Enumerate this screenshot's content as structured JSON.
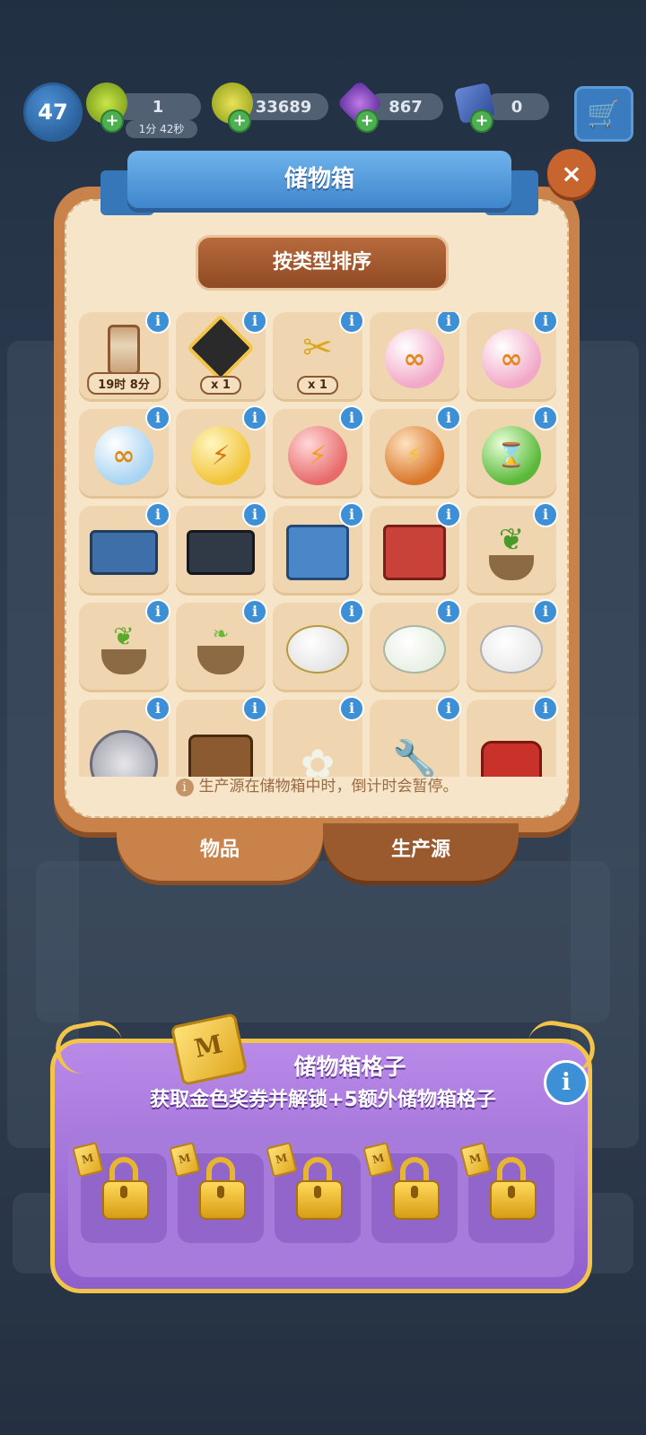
{
  "hud": {
    "level": "47",
    "energy_value": "1",
    "energy_timer": "1分 42秒",
    "coins_value": "33689",
    "gems_value": "867",
    "cards_value": "0",
    "plus_symbol": "+",
    "cart_icon": "cart-icon"
  },
  "storage": {
    "title": "储物箱",
    "close_symbol": "×",
    "sort_label": "按类型排序",
    "info_symbol": "i",
    "items": [
      {
        "name": "hourglass-timer",
        "badge": "19时 8分"
      },
      {
        "name": "energy-sign",
        "badge": "x 1"
      },
      {
        "name": "golden-scissors",
        "badge": "x 1"
      },
      {
        "name": "pink-infinity-orb",
        "badge": ""
      },
      {
        "name": "pink-infinity-orb",
        "badge": ""
      },
      {
        "name": "blue-infinity-orb",
        "badge": ""
      },
      {
        "name": "gold-energy-orb",
        "badge": ""
      },
      {
        "name": "red-energy-orb",
        "badge": ""
      },
      {
        "name": "orange-energy-orb",
        "badge": ""
      },
      {
        "name": "green-hourglass-orb",
        "badge": ""
      },
      {
        "name": "blue-toolbox-open",
        "badge": ""
      },
      {
        "name": "dark-toolbox",
        "badge": ""
      },
      {
        "name": "blue-toolbox-closed",
        "badge": ""
      },
      {
        "name": "red-toolbox",
        "badge": ""
      },
      {
        "name": "potted-plant-large",
        "badge": ""
      },
      {
        "name": "potted-plant-medium",
        "badge": ""
      },
      {
        "name": "potted-sprout",
        "badge": ""
      },
      {
        "name": "gold-piggy-bank",
        "badge": ""
      },
      {
        "name": "floral-piggy-bank",
        "badge": ""
      },
      {
        "name": "white-piggy-bank",
        "badge": ""
      },
      {
        "name": "silver-coin",
        "badge": ""
      },
      {
        "name": "tool-bucket",
        "badge": ""
      },
      {
        "name": "flower-bush",
        "badge": ""
      },
      {
        "name": "wrench-tool",
        "badge": ""
      },
      {
        "name": "red-chest",
        "badge": ""
      }
    ],
    "note": "生产源在储物箱中时，倒计时会暂停。",
    "note_icon": "i",
    "tab_items": "物品",
    "tab_producers": "生产源"
  },
  "slots_panel": {
    "title": "储物箱格子",
    "subtitle": "获取金色奖券并解锁+5额外储物箱格子",
    "ticket_letter": "M",
    "info_symbol": "i",
    "locked_slots": 5
  },
  "colors": {
    "panel": "#c9824a",
    "panel_inner": "#f6e5c8",
    "ribbon": "#4f97dc",
    "purple": "#a77bdc",
    "gold": "#f2c44a"
  }
}
